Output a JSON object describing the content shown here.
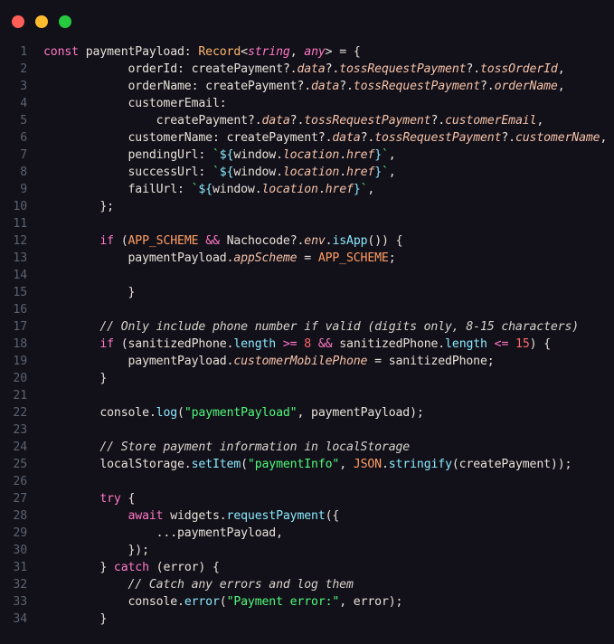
{
  "window": {
    "controls": {
      "close_color": "#ff5f56",
      "minimize_color": "#ffbd2e",
      "maximize_color": "#27c93f"
    }
  },
  "colors": {
    "plain": "#e8e2d8",
    "keyword": "#ff79c6",
    "type": "#ffb86c",
    "prop": "#f5c2a8",
    "method": "#8be9fd",
    "string": "#50fa7b",
    "number": "#ff6b6b",
    "operator": "#ff79c6",
    "comment": "#d8d4cc",
    "interp": "#8be9fd",
    "constant": "#ff9e64"
  },
  "code": {
    "lines": [
      {
        "n": "1",
        "indent": "",
        "toks": [
          {
            "t": "const ",
            "c": "keyword"
          },
          {
            "t": "paymentPayload: ",
            "c": "plain"
          },
          {
            "t": "Record",
            "c": "type"
          },
          {
            "t": "<",
            "c": "plain"
          },
          {
            "t": "string",
            "c": "keyword",
            "i": true
          },
          {
            "t": ", ",
            "c": "plain"
          },
          {
            "t": "any",
            "c": "keyword",
            "i": true
          },
          {
            "t": "> = {",
            "c": "plain"
          }
        ]
      },
      {
        "n": "2",
        "indent": "            ",
        "toks": [
          {
            "t": "orderId: createPayment?.",
            "c": "plain"
          },
          {
            "t": "data",
            "c": "prop",
            "i": true
          },
          {
            "t": "?.",
            "c": "plain"
          },
          {
            "t": "tossRequestPayment",
            "c": "prop",
            "i": true
          },
          {
            "t": "?.",
            "c": "plain"
          },
          {
            "t": "tossOrderId",
            "c": "prop",
            "i": true
          },
          {
            "t": ",",
            "c": "plain"
          }
        ]
      },
      {
        "n": "3",
        "indent": "            ",
        "toks": [
          {
            "t": "orderName: createPayment?.",
            "c": "plain"
          },
          {
            "t": "data",
            "c": "prop",
            "i": true
          },
          {
            "t": "?.",
            "c": "plain"
          },
          {
            "t": "tossRequestPayment",
            "c": "prop",
            "i": true
          },
          {
            "t": "?.",
            "c": "plain"
          },
          {
            "t": "orderName",
            "c": "prop",
            "i": true
          },
          {
            "t": ",",
            "c": "plain"
          }
        ]
      },
      {
        "n": "4",
        "indent": "            ",
        "toks": [
          {
            "t": "customerEmail:",
            "c": "plain"
          }
        ]
      },
      {
        "n": "5",
        "indent": "                ",
        "toks": [
          {
            "t": "createPayment?.",
            "c": "plain"
          },
          {
            "t": "data",
            "c": "prop",
            "i": true
          },
          {
            "t": "?.",
            "c": "plain"
          },
          {
            "t": "tossRequestPayment",
            "c": "prop",
            "i": true
          },
          {
            "t": "?.",
            "c": "plain"
          },
          {
            "t": "customerEmail",
            "c": "prop",
            "i": true
          },
          {
            "t": ",",
            "c": "plain"
          }
        ]
      },
      {
        "n": "6",
        "indent": "            ",
        "toks": [
          {
            "t": "customerName: createPayment?.",
            "c": "plain"
          },
          {
            "t": "data",
            "c": "prop",
            "i": true
          },
          {
            "t": "?.",
            "c": "plain"
          },
          {
            "t": "tossRequestPayment",
            "c": "prop",
            "i": true
          },
          {
            "t": "?.",
            "c": "plain"
          },
          {
            "t": "customerName",
            "c": "prop",
            "i": true
          },
          {
            "t": ",",
            "c": "plain"
          }
        ]
      },
      {
        "n": "7",
        "indent": "            ",
        "toks": [
          {
            "t": "pendingUrl: ",
            "c": "plain"
          },
          {
            "t": "`",
            "c": "string"
          },
          {
            "t": "${",
            "c": "interp"
          },
          {
            "t": "window.",
            "c": "plain"
          },
          {
            "t": "location",
            "c": "prop",
            "i": true
          },
          {
            "t": ".",
            "c": "plain"
          },
          {
            "t": "href",
            "c": "prop",
            "i": true
          },
          {
            "t": "}",
            "c": "interp"
          },
          {
            "t": "`",
            "c": "string"
          },
          {
            "t": ",",
            "c": "plain"
          }
        ]
      },
      {
        "n": "8",
        "indent": "            ",
        "toks": [
          {
            "t": "successUrl: ",
            "c": "plain"
          },
          {
            "t": "`",
            "c": "string"
          },
          {
            "t": "${",
            "c": "interp"
          },
          {
            "t": "window.",
            "c": "plain"
          },
          {
            "t": "location",
            "c": "prop",
            "i": true
          },
          {
            "t": ".",
            "c": "plain"
          },
          {
            "t": "href",
            "c": "prop",
            "i": true
          },
          {
            "t": "}",
            "c": "interp"
          },
          {
            "t": "`",
            "c": "string"
          },
          {
            "t": ",",
            "c": "plain"
          }
        ]
      },
      {
        "n": "9",
        "indent": "            ",
        "toks": [
          {
            "t": "failUrl: ",
            "c": "plain"
          },
          {
            "t": "`",
            "c": "string"
          },
          {
            "t": "${",
            "c": "interp"
          },
          {
            "t": "window.",
            "c": "plain"
          },
          {
            "t": "location",
            "c": "prop",
            "i": true
          },
          {
            "t": ".",
            "c": "plain"
          },
          {
            "t": "href",
            "c": "prop",
            "i": true
          },
          {
            "t": "}",
            "c": "interp"
          },
          {
            "t": "`",
            "c": "string"
          },
          {
            "t": ",",
            "c": "plain"
          }
        ]
      },
      {
        "n": "10",
        "indent": "        ",
        "toks": [
          {
            "t": "};",
            "c": "plain"
          }
        ]
      },
      {
        "n": "11",
        "indent": "",
        "toks": []
      },
      {
        "n": "12",
        "indent": "        ",
        "toks": [
          {
            "t": "if ",
            "c": "keyword"
          },
          {
            "t": "(",
            "c": "plain"
          },
          {
            "t": "APP_SCHEME",
            "c": "constant"
          },
          {
            "t": " ",
            "c": "plain"
          },
          {
            "t": "&&",
            "c": "operator"
          },
          {
            "t": " Nachocode?.",
            "c": "plain"
          },
          {
            "t": "env",
            "c": "prop",
            "i": true
          },
          {
            "t": ".",
            "c": "plain"
          },
          {
            "t": "isApp",
            "c": "method"
          },
          {
            "t": "()) {",
            "c": "plain"
          }
        ]
      },
      {
        "n": "13",
        "indent": "            ",
        "toks": [
          {
            "t": "paymentPayload.",
            "c": "plain"
          },
          {
            "t": "appScheme",
            "c": "prop",
            "i": true
          },
          {
            "t": " = ",
            "c": "plain"
          },
          {
            "t": "APP_SCHEME",
            "c": "constant"
          },
          {
            "t": ";",
            "c": "plain"
          }
        ]
      },
      {
        "n": "14",
        "indent": "",
        "toks": []
      },
      {
        "n": "15",
        "indent": "            ",
        "toks": [
          {
            "t": "}",
            "c": "plain"
          }
        ]
      },
      {
        "n": "16",
        "indent": "",
        "toks": []
      },
      {
        "n": "17",
        "indent": "        ",
        "toks": [
          {
            "t": "// Only include phone number if valid (digits only, 8-15 characters)",
            "c": "comment",
            "i": true
          }
        ]
      },
      {
        "n": "18",
        "indent": "        ",
        "toks": [
          {
            "t": "if ",
            "c": "keyword"
          },
          {
            "t": "(sanitizedPhone.",
            "c": "plain"
          },
          {
            "t": "length",
            "c": "method"
          },
          {
            "t": " ",
            "c": "plain"
          },
          {
            "t": ">=",
            "c": "operator"
          },
          {
            "t": " ",
            "c": "plain"
          },
          {
            "t": "8",
            "c": "number"
          },
          {
            "t": " ",
            "c": "plain"
          },
          {
            "t": "&&",
            "c": "operator"
          },
          {
            "t": " sanitizedPhone.",
            "c": "plain"
          },
          {
            "t": "length",
            "c": "method"
          },
          {
            "t": " ",
            "c": "plain"
          },
          {
            "t": "<=",
            "c": "operator"
          },
          {
            "t": " ",
            "c": "plain"
          },
          {
            "t": "15",
            "c": "number"
          },
          {
            "t": ") {",
            "c": "plain"
          }
        ]
      },
      {
        "n": "19",
        "indent": "            ",
        "toks": [
          {
            "t": "paymentPayload.",
            "c": "plain"
          },
          {
            "t": "customerMobilePhone",
            "c": "prop",
            "i": true
          },
          {
            "t": " = sanitizedPhone;",
            "c": "plain"
          }
        ]
      },
      {
        "n": "20",
        "indent": "        ",
        "toks": [
          {
            "t": "}",
            "c": "plain"
          }
        ]
      },
      {
        "n": "21",
        "indent": "",
        "toks": []
      },
      {
        "n": "22",
        "indent": "        ",
        "toks": [
          {
            "t": "console.",
            "c": "plain"
          },
          {
            "t": "log",
            "c": "method"
          },
          {
            "t": "(",
            "c": "plain"
          },
          {
            "t": "\"paymentPayload\"",
            "c": "string"
          },
          {
            "t": ", paymentPayload);",
            "c": "plain"
          }
        ]
      },
      {
        "n": "23",
        "indent": "",
        "toks": []
      },
      {
        "n": "24",
        "indent": "        ",
        "toks": [
          {
            "t": "// Store payment information in localStorage",
            "c": "comment",
            "i": true
          }
        ]
      },
      {
        "n": "25",
        "indent": "        ",
        "toks": [
          {
            "t": "localStorage.",
            "c": "plain"
          },
          {
            "t": "setItem",
            "c": "method"
          },
          {
            "t": "(",
            "c": "plain"
          },
          {
            "t": "\"paymentInfo\"",
            "c": "string"
          },
          {
            "t": ", ",
            "c": "plain"
          },
          {
            "t": "JSON",
            "c": "constant"
          },
          {
            "t": ".",
            "c": "plain"
          },
          {
            "t": "stringify",
            "c": "method"
          },
          {
            "t": "(createPayment));",
            "c": "plain"
          }
        ]
      },
      {
        "n": "26",
        "indent": "",
        "toks": []
      },
      {
        "n": "27",
        "indent": "        ",
        "toks": [
          {
            "t": "try",
            "c": "keyword"
          },
          {
            "t": " {",
            "c": "plain"
          }
        ]
      },
      {
        "n": "28",
        "indent": "            ",
        "toks": [
          {
            "t": "await",
            "c": "keyword"
          },
          {
            "t": " widgets.",
            "c": "plain"
          },
          {
            "t": "requestPayment",
            "c": "method"
          },
          {
            "t": "({",
            "c": "plain"
          }
        ]
      },
      {
        "n": "29",
        "indent": "                ",
        "toks": [
          {
            "t": "...paymentPayload,",
            "c": "plain"
          }
        ]
      },
      {
        "n": "30",
        "indent": "            ",
        "toks": [
          {
            "t": "});",
            "c": "plain"
          }
        ]
      },
      {
        "n": "31",
        "indent": "        ",
        "toks": [
          {
            "t": "} ",
            "c": "plain"
          },
          {
            "t": "catch",
            "c": "keyword"
          },
          {
            "t": " (error) {",
            "c": "plain"
          }
        ]
      },
      {
        "n": "32",
        "indent": "            ",
        "toks": [
          {
            "t": "// Catch any errors and log them",
            "c": "comment",
            "i": true
          }
        ]
      },
      {
        "n": "33",
        "indent": "            ",
        "toks": [
          {
            "t": "console.",
            "c": "plain"
          },
          {
            "t": "error",
            "c": "method"
          },
          {
            "t": "(",
            "c": "plain"
          },
          {
            "t": "\"Payment error:\"",
            "c": "string"
          },
          {
            "t": ", error);",
            "c": "plain"
          }
        ]
      },
      {
        "n": "34",
        "indent": "        ",
        "toks": [
          {
            "t": "}",
            "c": "plain"
          }
        ]
      }
    ]
  }
}
